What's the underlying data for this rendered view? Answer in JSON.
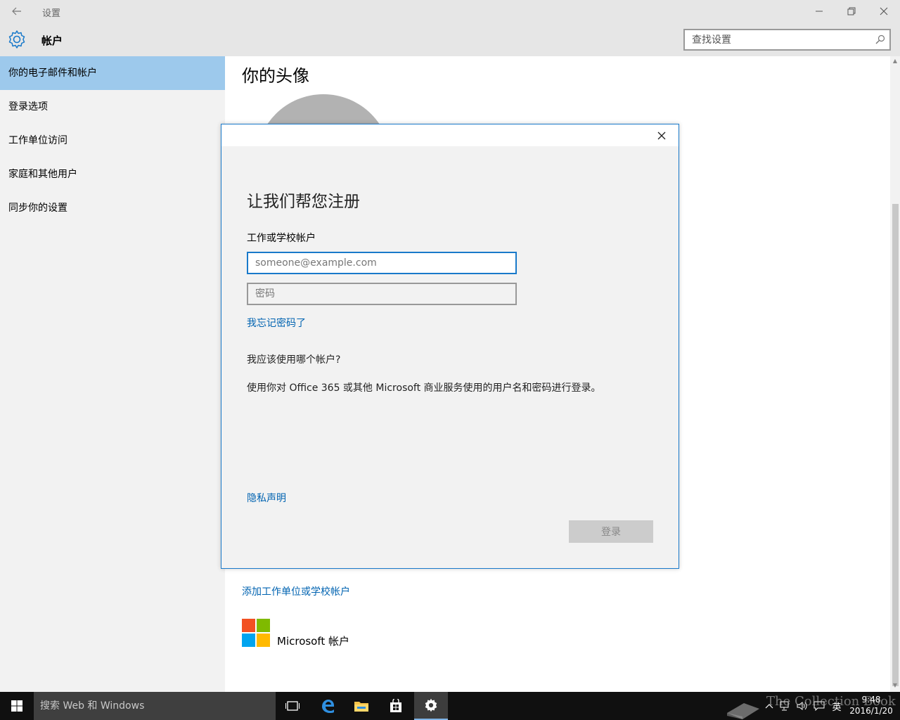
{
  "window": {
    "title": "设置"
  },
  "header": {
    "title": "帐户",
    "search_placeholder": "查找设置"
  },
  "sidebar": {
    "items": [
      {
        "label": "你的电子邮件和帐户",
        "active": true
      },
      {
        "label": "登录选项",
        "active": false
      },
      {
        "label": "工作单位访问",
        "active": false
      },
      {
        "label": "家庭和其他用户",
        "active": false
      },
      {
        "label": "同步你的设置",
        "active": false
      }
    ]
  },
  "main": {
    "title": "你的头像",
    "add_work_link": "添加工作单位或学校帐户",
    "microsoft_account_label": "Microsoft 帐户"
  },
  "dialog": {
    "title": "让我们帮您注册",
    "field_label": "工作或学校帐户",
    "email_placeholder": "someone@example.com",
    "password_placeholder": "密码",
    "forgot_password": "我忘记密码了",
    "which_account_heading": "我应该使用哪个帐户?",
    "which_account_text": "使用你对 Office 365 或其他 Microsoft 商业服务使用的用户名和密码进行登录。",
    "privacy_link": "隐私声明",
    "signin_button": "登录"
  },
  "taskbar": {
    "search_placeholder": "搜索 Web 和 Windows",
    "ime_label": "英",
    "time": "9:48",
    "date": "2016/1/20",
    "watermark": "The Collection Book"
  },
  "colors": {
    "accent": "#1979ca",
    "link": "#0063b1",
    "sidebar_active": "#9dc9ec",
    "taskbar": "#101010"
  }
}
